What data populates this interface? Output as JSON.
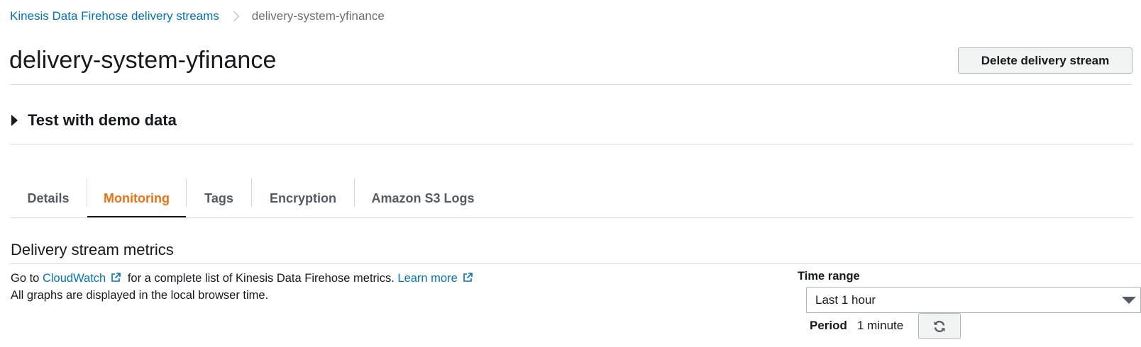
{
  "breadcrumb": {
    "parent": "Kinesis Data Firehose delivery streams",
    "current": "delivery-system-yfinance"
  },
  "header": {
    "title": "delivery-system-yfinance",
    "delete_label": "Delete delivery stream"
  },
  "demo_section": {
    "label": "Test with demo data"
  },
  "tabs": [
    {
      "label": "Details"
    },
    {
      "label": "Monitoring"
    },
    {
      "label": "Tags"
    },
    {
      "label": "Encryption"
    },
    {
      "label": "Amazon S3 Logs"
    }
  ],
  "active_tab": "Monitoring",
  "metrics": {
    "title": "Delivery stream metrics",
    "desc_prefix": "Go to",
    "cloudwatch_link": "CloudWatch",
    "desc_middle": "for a complete list of Kinesis Data Firehose metrics.",
    "learn_more_link": "Learn more",
    "desc_line2": "All graphs are displayed in the local browser time.",
    "time_range_label": "Time range",
    "time_range_value": "Last 1 hour",
    "period_label": "Period",
    "period_value": "1 minute"
  },
  "colors": {
    "link": "#0073bb",
    "active_tab": "#ec7211",
    "text": "#16191f",
    "muted": "#687078",
    "border": "#d5dbdb"
  },
  "icons": [
    "chevron-right-icon",
    "caret-right-icon",
    "external-link-icon",
    "caret-down-icon",
    "refresh-icon"
  ]
}
